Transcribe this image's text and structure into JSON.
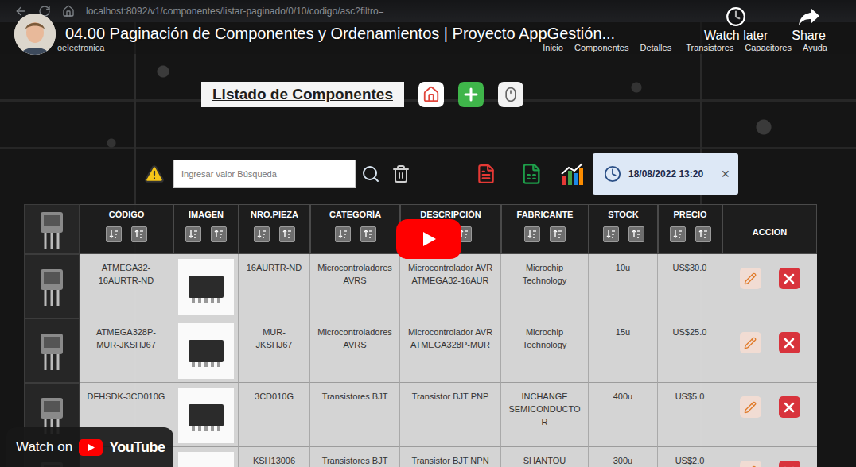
{
  "browser": {
    "url": "localhost:8092/v1/componentes/listar-paginado/0/10/codigo/asc?filtro="
  },
  "video": {
    "title": "04.00 Paginación de Componentes y Ordenamientos | Proyecto AppGestión...",
    "watch_later": "Watch later",
    "share": "Share",
    "watch_on": "Watch on",
    "brand": "YouTube"
  },
  "app": {
    "brand": "oelectronica",
    "nav_main": [
      "Inicio",
      "Componentes",
      "Detalles"
    ],
    "nav_more": [
      "Transistores",
      "Capacitores",
      "Ayuda"
    ],
    "heading": "Listado de Componentes",
    "search": {
      "placeholder": "Ingresar valor Búsqueda"
    },
    "date": {
      "value": "18/08/2022 13:20",
      "close": "✕"
    }
  },
  "table": {
    "columns": [
      {
        "label": "CÓDIGO",
        "sortable": true
      },
      {
        "label": "IMAGEN",
        "sortable": true
      },
      {
        "label": "NRO.PIEZA",
        "sortable": true
      },
      {
        "label": "CATEGORÍA",
        "sortable": true
      },
      {
        "label": "DESCRIPCIÓN",
        "sortable": true
      },
      {
        "label": "FABRICANTE",
        "sortable": true
      },
      {
        "label": "STOCK",
        "sortable": true
      },
      {
        "label": "PRECIO",
        "sortable": true
      },
      {
        "label": "ACCION",
        "sortable": false
      }
    ],
    "rows": [
      {
        "codigo": "ATMEGA32-16AURTR-ND",
        "nro_pieza": "16AURTR-ND",
        "categoria": "Microcontroladores AVRS",
        "descripcion": "Microcontrolador AVR ATMEGA32-16AUR",
        "fabricante": "Microchip Technology",
        "stock": "10u",
        "precio": "US$30.0"
      },
      {
        "codigo": "ATMEGA328P-MUR-JKSHJ67",
        "nro_pieza": "MUR-JKSHJ67",
        "categoria": "Microcontroladores AVRS",
        "descripcion": "Microcontrolador AVR ATMEGA328P-MUR",
        "fabricante": "Microchip Technology",
        "stock": "15u",
        "precio": "US$25.0"
      },
      {
        "codigo": "DFHSDK-3CD010G",
        "nro_pieza": "3CD010G",
        "categoria": "Transistores BJT",
        "descripcion": "Transistor BJT PNP",
        "fabricante": "INCHANGE SEMICONDUCTOR",
        "stock": "400u",
        "precio": "US$5.0"
      },
      {
        "codigo": "",
        "nro_pieza": "KSH13006",
        "categoria": "Transistores BJT",
        "descripcion": "Transistor BJT NPN",
        "fabricante": "SHANTOU",
        "stock": "300u",
        "precio": "US$2.0"
      }
    ]
  }
}
